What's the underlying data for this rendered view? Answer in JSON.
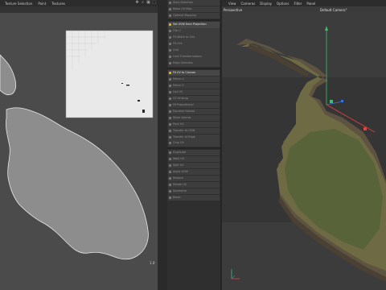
{
  "uv_editor": {
    "menu": [
      "Texture Selection",
      "Paint",
      "Textures"
    ],
    "corner_label": "1.0"
  },
  "tools": [
    {
      "label": "Start Selection",
      "active": false
    },
    {
      "label": "Relax UV Map",
      "active": false
    },
    {
      "label": "Optimal Mapping",
      "active": false
    },
    {
      "label": "Set UVW from Projection",
      "active": true
    },
    {
      "label": "Flip U",
      "active": false
    },
    {
      "label": "Fit Width to UVs",
      "active": false
    },
    {
      "label": "Fit UVs",
      "active": false
    },
    {
      "label": "Grid",
      "active": false
    },
    {
      "label": "Lock Transformations",
      "active": false
    },
    {
      "label": "Edge Selection",
      "active": false
    },
    {
      "label": "Fit UV to Canvas",
      "active": true
    },
    {
      "label": "Mirror U",
      "active": false
    },
    {
      "label": "Mirror V",
      "active": false
    },
    {
      "label": "Get UV",
      "active": false
    },
    {
      "label": "UV Unwrap",
      "active": false
    },
    {
      "label": "Fit Proportional",
      "active": false
    },
    {
      "label": "Equalize Islands",
      "active": false
    },
    {
      "label": "Stack Islands",
      "active": false
    },
    {
      "label": "Pack UV",
      "active": false
    },
    {
      "label": "Transfer to UVW",
      "active": false
    },
    {
      "label": "Transfer to Edge",
      "active": false
    },
    {
      "label": "Crop UV",
      "active": false
    },
    {
      "label": "Duplicate",
      "active": false
    },
    {
      "label": "Weld UV",
      "active": false
    },
    {
      "label": "Split UV",
      "active": false
    },
    {
      "label": "Apply UVW",
      "active": false
    },
    {
      "label": "Restore",
      "active": false
    },
    {
      "label": "Rotate UV",
      "active": false
    },
    {
      "label": "Normalize",
      "active": false
    },
    {
      "label": "Bevel",
      "active": false
    }
  ],
  "viewport": {
    "menu": [
      "View",
      "Cameras",
      "Display",
      "Options",
      "Filter",
      "Panel"
    ],
    "view_name": "Perspective",
    "camera_name": "Default Camera",
    "camera_suffix": "°"
  },
  "colors": {
    "island_fill": "#8d8d8d",
    "texture_bg": "#e9e9e9",
    "terrain_brown": "#6b5a3c",
    "terrain_green": "#5b6a3b",
    "axis_y": "#3fbf6a",
    "axis_x": "#e04040",
    "axis_z": "#3a6fe0"
  }
}
